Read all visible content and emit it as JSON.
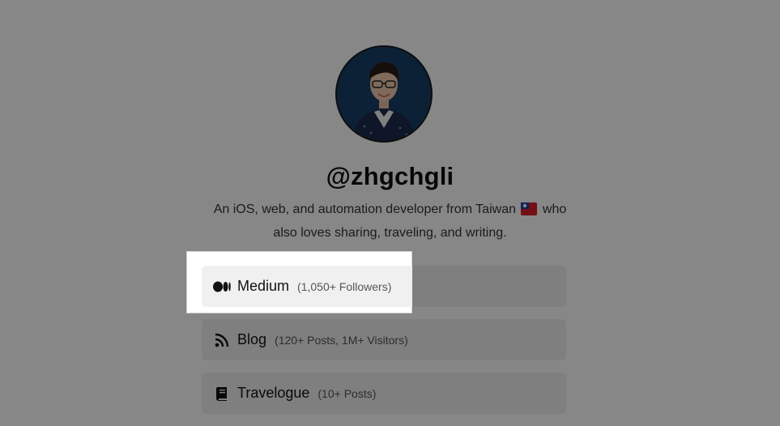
{
  "profile": {
    "handle": "@zhgchgli",
    "bio_before_flag": "An iOS, web, and automation developer from Taiwan",
    "bio_after_flag": "who also loves sharing, traveling, and writing.",
    "flag_icon": "taiwan-flag-icon"
  },
  "links": [
    {
      "label": "Medium",
      "meta": "(1,050+ Followers)",
      "icon": "medium-icon"
    },
    {
      "label": "Blog",
      "meta": "(120+ Posts, 1M+ Visitors)",
      "icon": "rss-icon"
    },
    {
      "label": "Travelogue",
      "meta": "(10+ Posts)",
      "icon": "book-icon"
    }
  ],
  "colors": {
    "card_background": "#f0f0f0",
    "overlay": "rgba(0,0,0,0.47)",
    "text_primary": "#111111",
    "text_secondary": "#555555"
  }
}
